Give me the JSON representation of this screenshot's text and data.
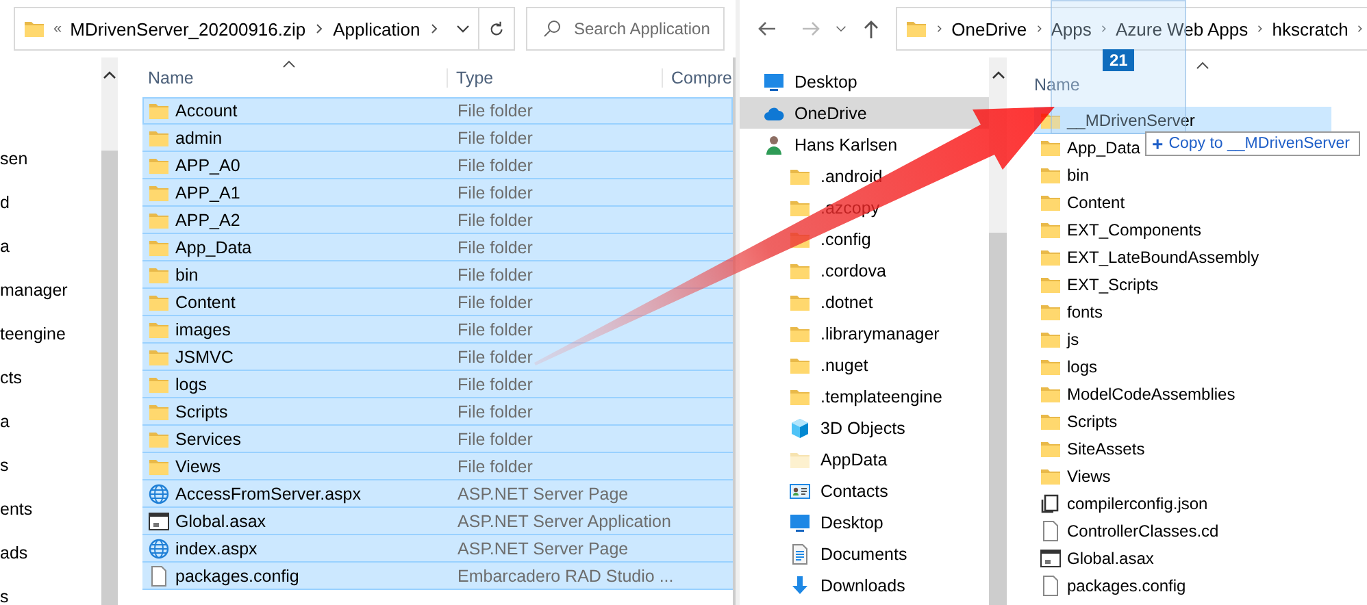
{
  "left_window": {
    "address": {
      "overflow": "«",
      "path": [
        "MDrivenServer_20200916.zip",
        "Application"
      ]
    },
    "search": {
      "placeholder": "Search Application"
    },
    "nav_items": [
      "sen",
      "d",
      "a",
      "manager",
      "teengine",
      "cts",
      "a",
      "s",
      "ents",
      "ads",
      "s"
    ],
    "columns": [
      "Name",
      "Type",
      "Compre"
    ],
    "rows": [
      {
        "name": "Account",
        "type": "File folder",
        "kind": "folder",
        "selected": true
      },
      {
        "name": "admin",
        "type": "File folder",
        "kind": "folder",
        "selected": true
      },
      {
        "name": "APP_A0",
        "type": "File folder",
        "kind": "folder",
        "selected": true
      },
      {
        "name": "APP_A1",
        "type": "File folder",
        "kind": "folder",
        "selected": true
      },
      {
        "name": "APP_A2",
        "type": "File folder",
        "kind": "folder",
        "selected": true
      },
      {
        "name": "App_Data",
        "type": "File folder",
        "kind": "folder",
        "selected": true
      },
      {
        "name": "bin",
        "type": "File folder",
        "kind": "folder",
        "selected": true
      },
      {
        "name": "Content",
        "type": "File folder",
        "kind": "folder",
        "selected": true
      },
      {
        "name": "images",
        "type": "File folder",
        "kind": "folder",
        "selected": true
      },
      {
        "name": "JSMVC",
        "type": "File folder",
        "kind": "folder",
        "selected": true
      },
      {
        "name": "logs",
        "type": "File folder",
        "kind": "folder",
        "selected": true
      },
      {
        "name": "Scripts",
        "type": "File folder",
        "kind": "folder",
        "selected": true
      },
      {
        "name": "Services",
        "type": "File folder",
        "kind": "folder",
        "selected": true
      },
      {
        "name": "Views",
        "type": "File folder",
        "kind": "folder",
        "selected": true
      },
      {
        "name": "AccessFromServer.aspx",
        "type": "ASP.NET Server Page",
        "kind": "web",
        "selected": true
      },
      {
        "name": "Global.asax",
        "type": "ASP.NET Server Application",
        "kind": "app",
        "selected": true
      },
      {
        "name": "index.aspx",
        "type": "ASP.NET Server Page",
        "kind": "web",
        "selected": true
      },
      {
        "name": "packages.config",
        "type": "Embarcadero RAD Studio ...",
        "kind": "file",
        "selected": true
      }
    ]
  },
  "right_window": {
    "breadcrumbs": [
      "OneDrive",
      "Apps",
      "Azure Web Apps",
      "hkscratch"
    ],
    "nav_items": [
      {
        "label": "Desktop",
        "kind": "desktop",
        "selected": false
      },
      {
        "label": "OneDrive",
        "kind": "cloud",
        "selected": true
      },
      {
        "label": "Hans Karlsen",
        "kind": "user",
        "selected": false,
        "children": [
          {
            "label": ".android",
            "kind": "folder",
            "selected": false
          },
          {
            "label": ".azcopy",
            "kind": "folder",
            "selected": false
          },
          {
            "label": ".config",
            "kind": "folder",
            "selected": false
          },
          {
            "label": ".cordova",
            "kind": "folder",
            "selected": false
          },
          {
            "label": ".dotnet",
            "kind": "folder",
            "selected": false
          },
          {
            "label": ".librarymanager",
            "kind": "folder",
            "selected": false
          },
          {
            "label": ".nuget",
            "kind": "folder",
            "selected": false
          },
          {
            "label": ".templateengine",
            "kind": "folder",
            "selected": false
          },
          {
            "label": "3D Objects",
            "kind": "cube",
            "selected": false
          },
          {
            "label": "AppData",
            "kind": "faded-folder",
            "selected": false
          },
          {
            "label": "Contacts",
            "kind": "contacts",
            "selected": false
          },
          {
            "label": "Desktop",
            "kind": "desktop",
            "selected": false
          },
          {
            "label": "Documents",
            "kind": "documents",
            "selected": false
          },
          {
            "label": "Downloads",
            "kind": "downloads",
            "selected": false
          }
        ]
      }
    ],
    "column": "Name",
    "rows": [
      {
        "name": "__MDrivenServer",
        "kind": "folder",
        "selected": true
      },
      {
        "name": "App_Data",
        "kind": "folder",
        "selected": false
      },
      {
        "name": "bin",
        "kind": "folder",
        "selected": false
      },
      {
        "name": "Content",
        "kind": "folder",
        "selected": false
      },
      {
        "name": "EXT_Components",
        "kind": "folder",
        "selected": false
      },
      {
        "name": "EXT_LateBoundAssembly",
        "kind": "folder",
        "selected": false
      },
      {
        "name": "EXT_Scripts",
        "kind": "folder",
        "selected": false
      },
      {
        "name": "fonts",
        "kind": "folder",
        "selected": false
      },
      {
        "name": "js",
        "kind": "folder",
        "selected": false
      },
      {
        "name": "logs",
        "kind": "folder",
        "selected": false
      },
      {
        "name": "ModelCodeAssemblies",
        "kind": "folder",
        "selected": false
      },
      {
        "name": "Scripts",
        "kind": "folder",
        "selected": false
      },
      {
        "name": "SiteAssets",
        "kind": "folder",
        "selected": false
      },
      {
        "name": "Views",
        "kind": "folder",
        "selected": false
      },
      {
        "name": "compilerconfig.json",
        "kind": "json",
        "selected": false
      },
      {
        "name": "ControllerClasses.cd",
        "kind": "file",
        "selected": false
      },
      {
        "name": "Global.asax",
        "kind": "app",
        "selected": false
      },
      {
        "name": "packages.config",
        "kind": "file",
        "selected": false
      }
    ]
  },
  "drag": {
    "count": "21",
    "tooltip_sign": "+",
    "tooltip_text": "Copy to __MDrivenServer"
  }
}
